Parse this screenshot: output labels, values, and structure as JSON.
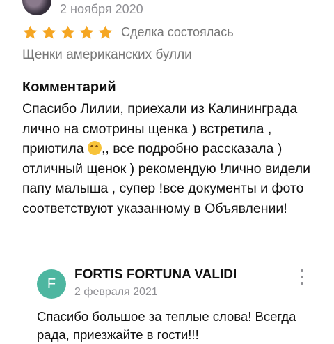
{
  "review": {
    "date": "2 ноября 2020",
    "rating": 5,
    "deal_status": "Сделка состоялась",
    "listing_title": "Щенки американских булли",
    "comment_heading": "Комментарий",
    "comment_part1": "Спасибо Лилии, приехали из Калининграда лично на смотрины щенка ) встретила , приютила ",
    "comment_emoji": "hugging-face-emoji",
    "comment_part2": ",, все подробно рассказала ) отличный щенок ) рекомендую !лично видели папу малыша , супер !все документы и фото соответствуют указанному в Объявлении!"
  },
  "reply": {
    "avatar_letter": "F",
    "avatar_color": "#4db6a0",
    "author": "FORTIS FORTUNA VALIDI",
    "date": "2 февраля 2021",
    "body": "Спасибо большое за теплые слова! Всегда рада, приезжайте в гости!!!"
  },
  "colors": {
    "star": "#f5a623",
    "muted_text": "#8e8e93"
  }
}
